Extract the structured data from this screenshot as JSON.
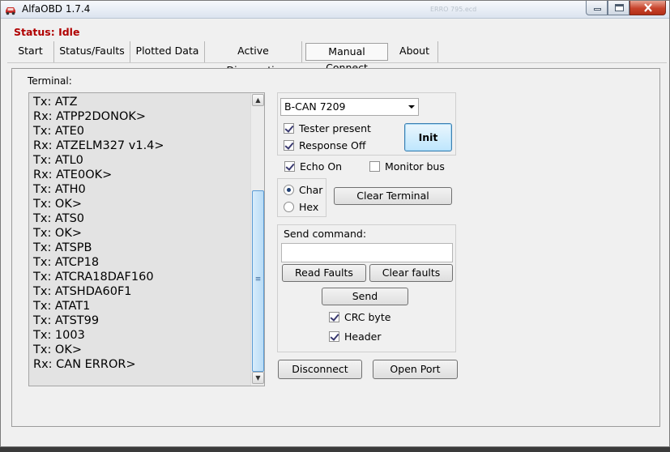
{
  "window": {
    "title": "AlfaOBD 1.7.4",
    "background_hint": "ERRO 795.ecd"
  },
  "status": {
    "text": "Status: Idle",
    "color": "#b00000"
  },
  "tabs": [
    {
      "label": "Start",
      "active": false
    },
    {
      "label": "Status/Faults",
      "active": false
    },
    {
      "label": "Plotted Data",
      "active": false
    },
    {
      "label": "Active Diagnostic",
      "active": false
    },
    {
      "label": "Manual Connect",
      "active": true
    },
    {
      "label": "About",
      "active": false
    }
  ],
  "terminal": {
    "label": "Terminal:",
    "lines": [
      "Tx: ATZ",
      "Rx: ATPP2DONOK>",
      "Tx: ATE0",
      "Rx: ATZELM327 v1.4>",
      "Tx: ATL0",
      "Rx: ATE0OK>",
      "Tx: ATH0",
      "Tx: OK>",
      "Tx: ATS0",
      "Tx: OK>",
      "Tx: ATSPB",
      "Tx: ATCP18",
      "Tx: ATCRA18DAF160",
      "Tx: ATSHDA60F1",
      "Tx: ATAT1",
      "Tx: ATST99",
      "Tx: 1003",
      "Tx: OK>",
      "Rx: CAN ERROR>"
    ]
  },
  "connection": {
    "bus_select": "B-CAN 7209",
    "tester_present": {
      "label": "Tester present",
      "checked": true
    },
    "response_off": {
      "label": "Response Off",
      "checked": true
    },
    "init_label": "Init"
  },
  "echo_on": {
    "label": "Echo On",
    "checked": true
  },
  "monitor_bus": {
    "label": "Monitor bus",
    "checked": false
  },
  "display_mode": {
    "char": {
      "label": "Char",
      "selected": true
    },
    "hex": {
      "label": "Hex",
      "selected": false
    }
  },
  "clear_terminal_label": "Clear Terminal",
  "command": {
    "label": "Send command:",
    "value": "",
    "read_faults_label": "Read Faults",
    "clear_faults_label": "Clear faults",
    "send_label": "Send",
    "crc_byte": {
      "label": "CRC byte",
      "checked": true
    },
    "header": {
      "label": "Header",
      "checked": true
    }
  },
  "footer_buttons": {
    "disconnect_label": "Disconnect",
    "open_port_label": "Open Port"
  },
  "icons": {
    "app": "car-icon",
    "scroll_up": "arrow-up-icon",
    "scroll_down": "arrow-down-icon",
    "dropdown": "chevron-down-icon"
  }
}
